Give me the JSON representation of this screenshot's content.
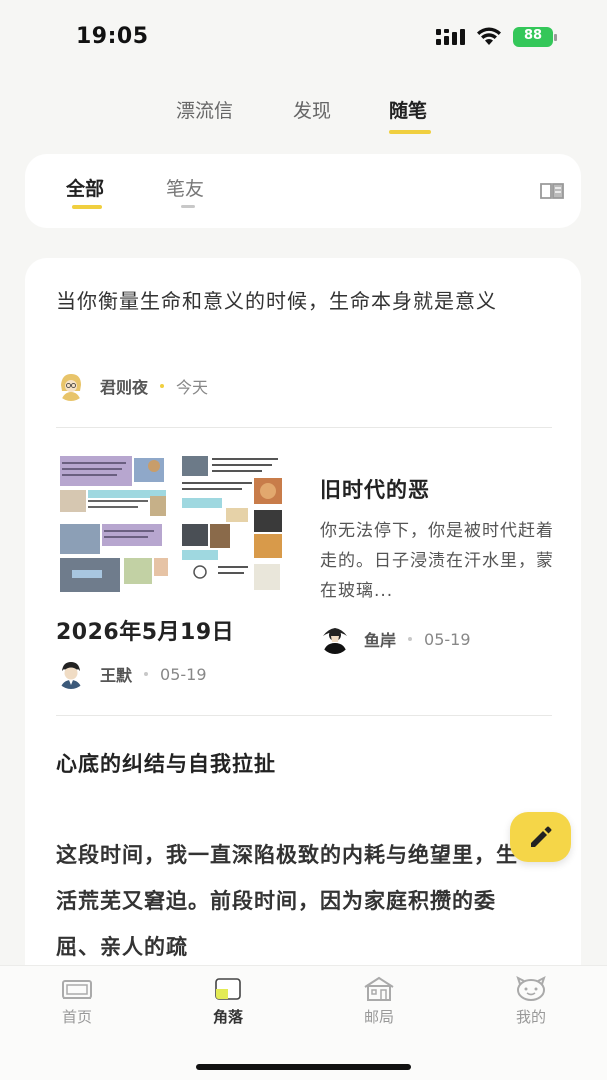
{
  "status_bar": {
    "time": "19:05",
    "battery": "88"
  },
  "top_tabs": [
    {
      "label": "漂流信"
    },
    {
      "label": "发现"
    },
    {
      "label": "随笔"
    }
  ],
  "sub_tabs": [
    {
      "label": "全部"
    },
    {
      "label": "笔友"
    }
  ],
  "feed": {
    "quote_post": {
      "text": "当你衡量生命和意义的时候，生命本身就是意义",
      "author": "君则夜",
      "date": "今天"
    },
    "photo_post": {
      "title": "2026年5月19日",
      "author": "王默",
      "date": "05-19"
    },
    "article_post": {
      "title": "旧时代的恶",
      "excerpt": "你无法停下，你是被时代赶着走的。日子浸渍在汗水里，蒙在玻璃...",
      "author": "鱼岸",
      "date": "05-19"
    },
    "long_post": {
      "title": "心底的纠结与自我拉扯",
      "body": "这段时间，我一直深陷极致的内耗与绝望里，生活荒芜又窘迫。前段时间，因为家庭积攒的委屈、亲人的疏"
    }
  },
  "bottom_nav": [
    {
      "label": "首页"
    },
    {
      "label": "角落"
    },
    {
      "label": "邮局"
    },
    {
      "label": "我的"
    }
  ],
  "colors": {
    "accent": "#f0cf3f",
    "fab": "#f5d648",
    "battery": "#34c759"
  }
}
